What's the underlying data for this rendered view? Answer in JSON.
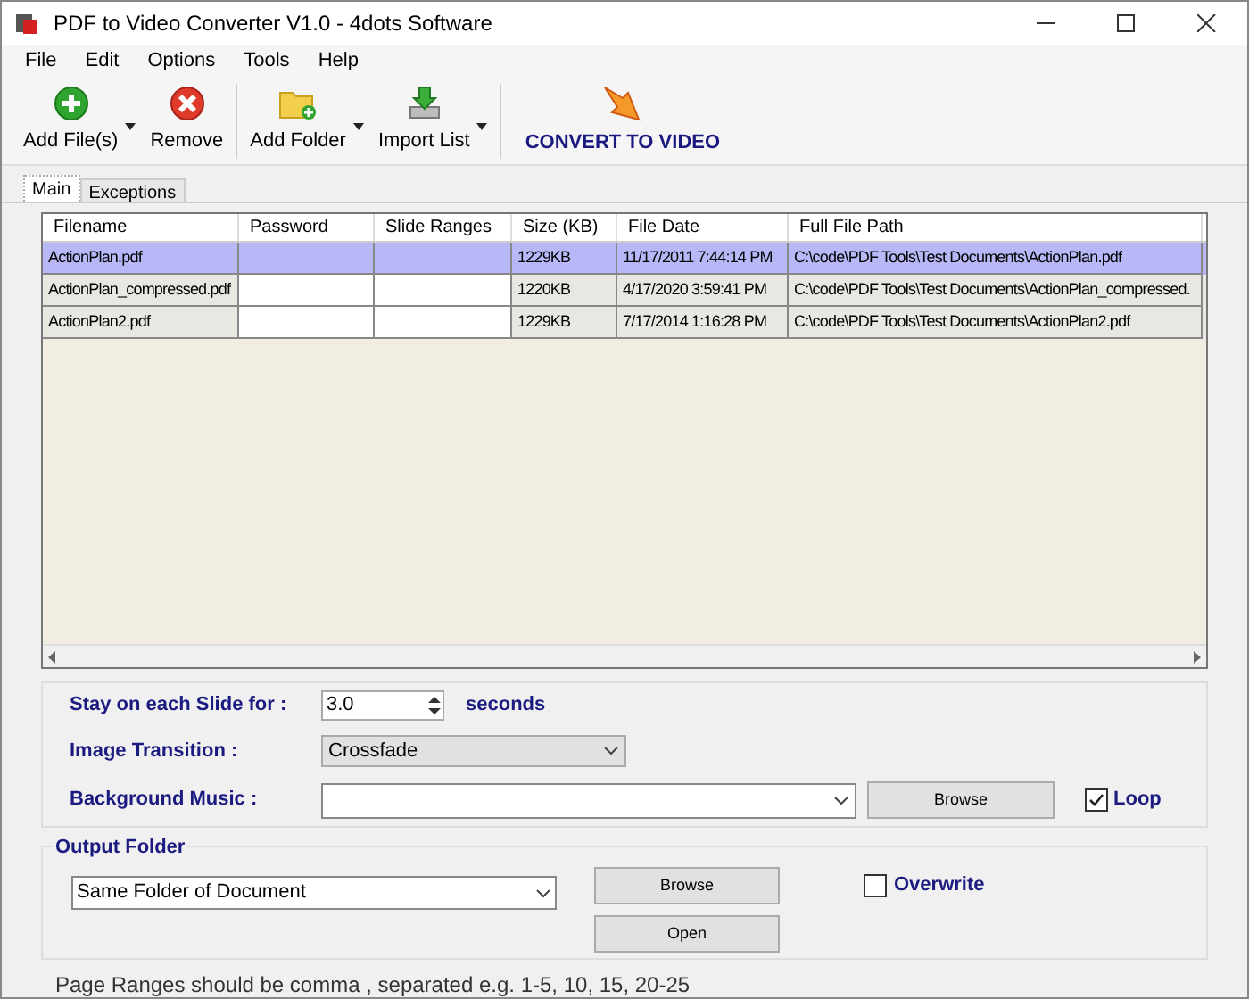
{
  "window": {
    "title": "PDF to Video Converter V1.0 - 4dots Software"
  },
  "menu": [
    "File",
    "Edit",
    "Options",
    "Tools",
    "Help"
  ],
  "toolbar": [
    {
      "kind": "add",
      "label": "Add File(s)",
      "dropdown": true
    },
    {
      "kind": "remove",
      "label": "Remove",
      "dropdown": false
    },
    {
      "kind": "folder",
      "label": "Add Folder",
      "dropdown": true
    },
    {
      "kind": "import",
      "label": "Import List",
      "dropdown": true
    },
    {
      "kind": "convert",
      "label": "CONVERT TO VIDEO",
      "dropdown": false
    }
  ],
  "tabs": [
    {
      "label": "Main",
      "selected": true
    },
    {
      "label": "Exceptions",
      "selected": false
    }
  ],
  "table": {
    "columns": [
      "Filename",
      "Password",
      "Slide Ranges",
      "Size (KB)",
      "File Date",
      "Full File Path"
    ],
    "rows": [
      {
        "selected": true,
        "cells": [
          "ActionPlan.pdf",
          "",
          "",
          "1229KB",
          "11/17/2011 7:44:14 PM",
          "C:\\code\\PDF Tools\\Test Documents\\ActionPlan.pdf"
        ]
      },
      {
        "selected": false,
        "cells": [
          "ActionPlan_compressed.pdf",
          "",
          "",
          "1220KB",
          "4/17/2020 3:59:41 PM",
          "C:\\code\\PDF Tools\\Test Documents\\ActionPlan_compressed."
        ]
      },
      {
        "selected": false,
        "cells": [
          "ActionPlan2.pdf",
          "",
          "",
          "1229KB",
          "7/17/2014 1:16:28 PM",
          "C:\\code\\PDF Tools\\Test Documents\\ActionPlan2.pdf"
        ]
      }
    ]
  },
  "settings": {
    "duration": {
      "label": "Stay on each Slide for :",
      "value": "3.0",
      "unit": "seconds"
    },
    "transition": {
      "label": "Image Transition :",
      "value": "Crossfade"
    },
    "music": {
      "label": "Background Music :",
      "button": "Browse",
      "loop": {
        "label": "Loop",
        "checked": true
      }
    }
  },
  "output": {
    "title": "Output Folder",
    "folder": "Same Folder of Document",
    "browse": "Browse",
    "open": "Open",
    "overwrite": {
      "label": "Overwrite",
      "checked": false
    }
  },
  "footer": "Page Ranges should be comma , separated e.g. 1-5, 10, 15, 20-25"
}
